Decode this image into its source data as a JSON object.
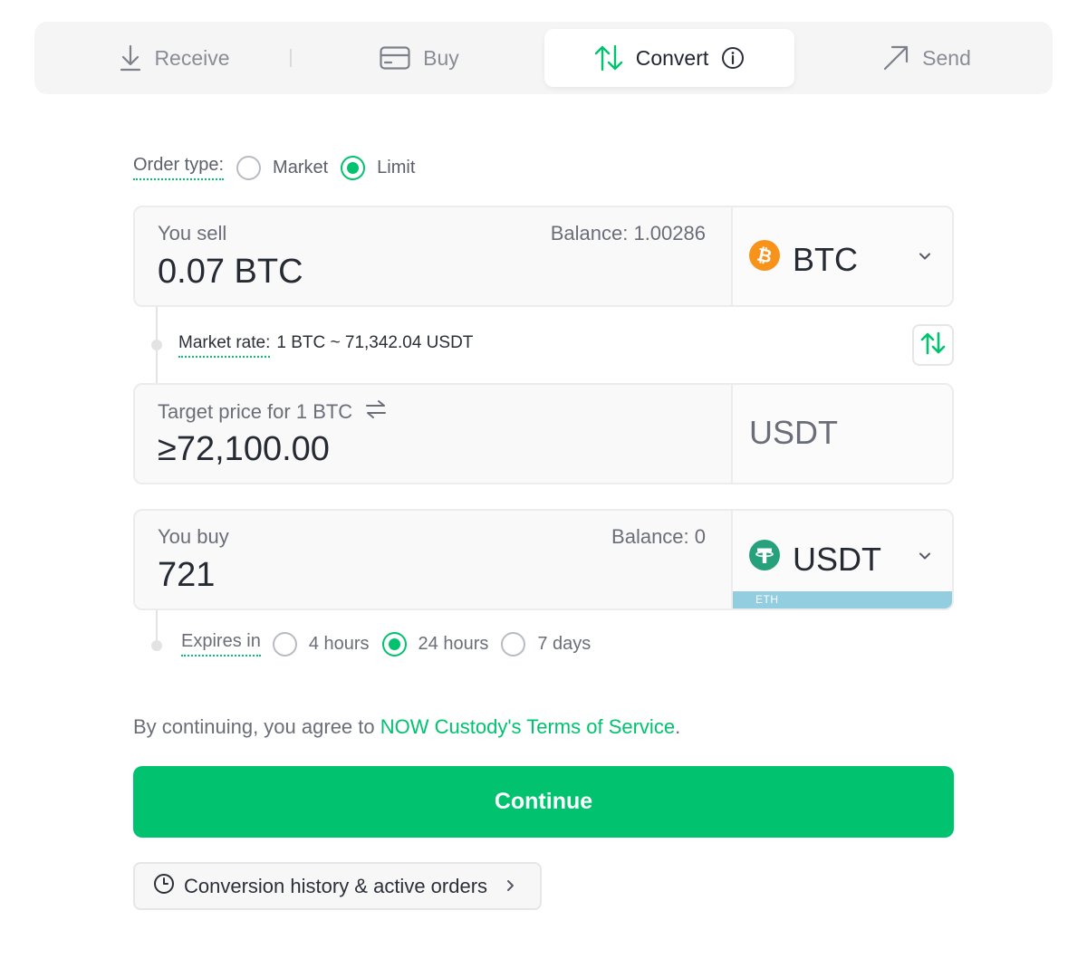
{
  "tabs": {
    "receive": "Receive",
    "buy": "Buy",
    "convert": "Convert",
    "send": "Send"
  },
  "order_type": {
    "label": "Order type:",
    "options": [
      "Market",
      "Limit"
    ],
    "selected": "Limit"
  },
  "sell": {
    "label": "You sell",
    "amount": "0.07 BTC",
    "balance": "Balance: 1.00286",
    "coin": "BTC",
    "coin_icon": "bitcoin-icon",
    "coin_color": "#f7931a"
  },
  "market_rate": {
    "label": "Market rate:",
    "value": "1 BTC ~ 71,342.04 USDT"
  },
  "target": {
    "label": "Target price for 1 BTC",
    "value": "≥72,100.00",
    "currency": "USDT"
  },
  "buy": {
    "label": "You buy",
    "amount": "721",
    "balance": "Balance: 0",
    "coin": "USDT",
    "coin_icon": "tether-icon",
    "coin_color": "#26a17b",
    "network": "ETH"
  },
  "expires": {
    "label": "Expires in",
    "options": [
      "4 hours",
      "24 hours",
      "7 days"
    ],
    "selected": "24 hours"
  },
  "terms": {
    "prefix": "By continuing, you agree to ",
    "link": "NOW Custody's Terms of Service",
    "suffix": "."
  },
  "continue_label": "Continue",
  "history_label": "Conversion history & active orders",
  "colors": {
    "accent": "#00c26f",
    "network_strip": "#92cde0"
  }
}
